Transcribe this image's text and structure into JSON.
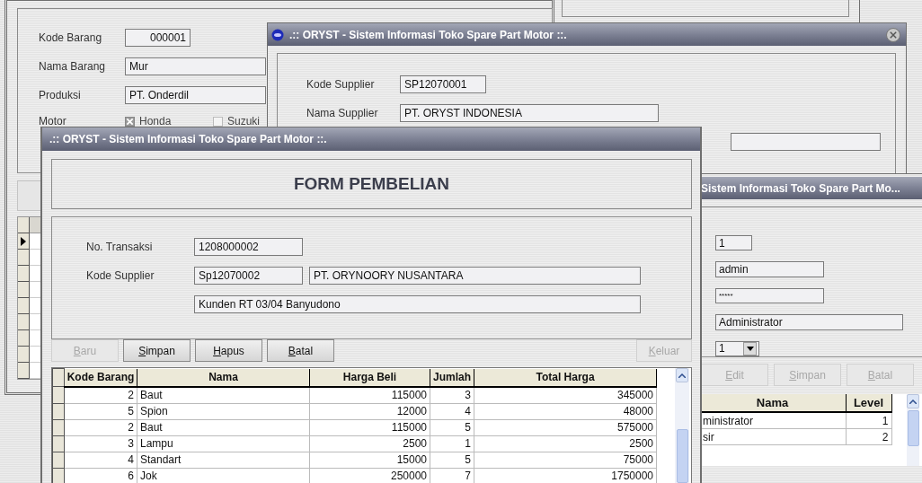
{
  "barang_window": {
    "fields": [
      {
        "label": "Kode Barang",
        "value": "000001"
      },
      {
        "label": "Nama Barang",
        "value": "Mur"
      },
      {
        "label": "Produksi",
        "value": "PT. Onderdil"
      }
    ],
    "motor": {
      "label": "Motor",
      "options": [
        {
          "label": "Honda",
          "checked": true
        },
        {
          "label": "Suzuki",
          "checked": false
        }
      ]
    },
    "grid": {
      "rows": [
        {
          "selected": true
        },
        {
          "selected": false
        },
        {
          "selected": false
        },
        {
          "selected": false
        },
        {
          "selected": false
        },
        {
          "selected": false
        },
        {
          "selected": false
        },
        {
          "selected": false
        },
        {
          "selected": false
        }
      ]
    }
  },
  "supplier_window": {
    "title": ".:: ORYST - Sistem Informasi Toko Spare Part Motor ::.",
    "fields": [
      {
        "label": "Kode Supplier",
        "value": "SP12070001"
      },
      {
        "label": "Nama Supplier",
        "value": "PT. ORYST INDONESIA"
      }
    ]
  },
  "user_window": {
    "title": "Sistem Informasi Toko Spare Part Mo...",
    "fields": [
      {
        "kind": "short",
        "value": "1"
      },
      {
        "kind": "text",
        "value": "admin"
      },
      {
        "kind": "password",
        "value": "*****"
      },
      {
        "kind": "wide",
        "value": "Administrator"
      },
      {
        "kind": "combo",
        "value": "1"
      }
    ],
    "buttons": [
      {
        "label": "Edit",
        "disabled": true
      },
      {
        "label": "Simpan",
        "disabled": true
      },
      {
        "label": "Batal",
        "disabled": true
      }
    ],
    "table": {
      "columns": [
        "Nama",
        "Level"
      ],
      "rows": [
        [
          "ministrator",
          "1"
        ],
        [
          "sir",
          "2"
        ]
      ]
    }
  },
  "form_window": {
    "title": ".:: ORYST - Sistem Informasi Toko Spare Part Motor ::.",
    "heading": "FORM PEMBELIAN",
    "no_transaksi": {
      "label": "No. Transaksi",
      "value": "1208000002"
    },
    "kode_supplier": {
      "label": "Kode Supplier",
      "value": "Sp12070002"
    },
    "nama_supplier": {
      "value": "PT. ORYNOORY NUSANTARA"
    },
    "alamat": {
      "value": "Kunden RT 03/04 Banyudono"
    },
    "buttons": [
      {
        "label": "Baru",
        "disabled": true
      },
      {
        "label": "Simpan",
        "disabled": false
      },
      {
        "label": "Hapus",
        "disabled": false
      },
      {
        "label": "Batal",
        "disabled": false
      },
      {
        "label": "Keluar",
        "disabled": true
      }
    ],
    "table": {
      "columns": [
        "Kode Barang",
        "Nama",
        "Harga Beli",
        "Jumlah",
        "Total Harga"
      ],
      "rows": [
        [
          "2",
          "Baut",
          "115000",
          "3",
          "345000"
        ],
        [
          "5",
          "Spion",
          "12000",
          "4",
          "48000"
        ],
        [
          "2",
          "Baut",
          "115000",
          "5",
          "575000"
        ],
        [
          "3",
          "Lampu",
          "2500",
          "1",
          "2500"
        ],
        [
          "4",
          "Standart",
          "15000",
          "5",
          "75000"
        ],
        [
          "6",
          "Jok",
          "250000",
          "7",
          "1750000"
        ]
      ]
    }
  }
}
